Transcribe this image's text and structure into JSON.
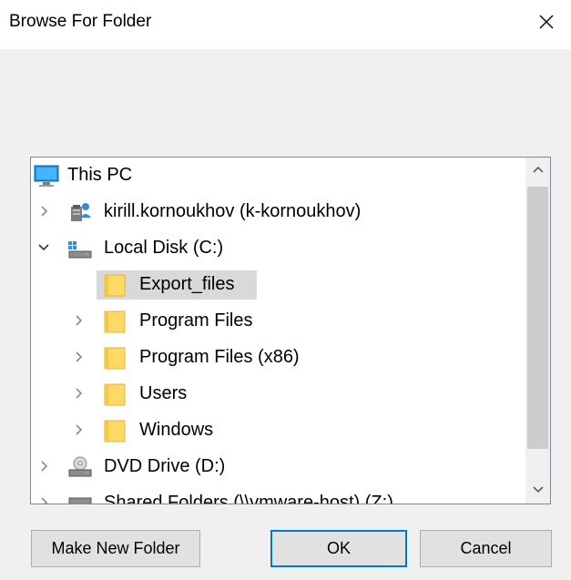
{
  "window": {
    "title": "Browse For Folder",
    "close_glyph": "✕"
  },
  "tree": {
    "items": [
      {
        "label": "This PC",
        "icon": "monitor-icon",
        "expander": "none",
        "level": 0
      },
      {
        "label": "kirill.kornoukhov (k-kornoukhov)",
        "icon": "user-folder-icon",
        "expander": "collapsed",
        "level": 1
      },
      {
        "label": "Local Disk (C:)",
        "icon": "drive-icon",
        "expander": "expanded",
        "level": 1
      },
      {
        "label": "Export_files",
        "icon": "folder-icon",
        "expander": "none",
        "level": 2,
        "selected": true
      },
      {
        "label": "Program Files",
        "icon": "folder-icon",
        "expander": "collapsed",
        "level": 2
      },
      {
        "label": "Program Files (x86)",
        "icon": "folder-icon",
        "expander": "collapsed",
        "level": 2
      },
      {
        "label": "Users",
        "icon": "folder-icon",
        "expander": "collapsed",
        "level": 2
      },
      {
        "label": "Windows",
        "icon": "folder-icon",
        "expander": "collapsed",
        "level": 2
      },
      {
        "label": "DVD Drive (D:)",
        "icon": "dvd-drive-icon",
        "expander": "collapsed",
        "level": 1
      },
      {
        "label": "Shared Folders (\\\\vmware-host) (Z:)",
        "icon": "network-drive-icon",
        "expander": "collapsed",
        "level": 1
      }
    ]
  },
  "buttons": {
    "make_new_folder": "Make New Folder",
    "ok": "OK",
    "cancel": "Cancel"
  },
  "colors": {
    "folder": "#ffd966",
    "selection": "#d9d9d9",
    "default_button_border": "#0078d7"
  }
}
